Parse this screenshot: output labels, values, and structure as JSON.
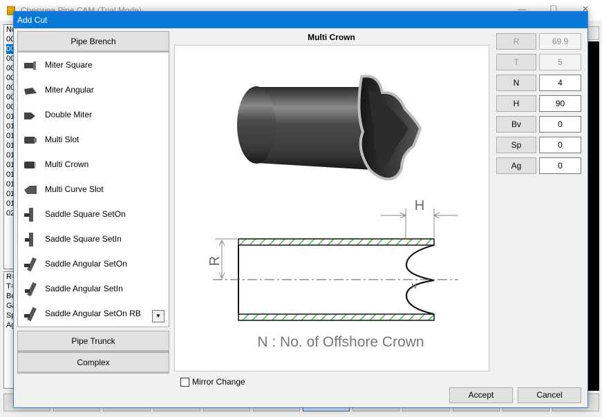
{
  "background_window": {
    "title": "Cheswee Pipe CAM (Trial Mode)",
    "list_header": "No",
    "list_rows": [
      "00",
      "00",
      "00",
      "00",
      "00",
      "00",
      "00",
      "00",
      "01",
      "01",
      "01",
      "01",
      "01",
      "01",
      "01",
      "01",
      "01",
      "01",
      "02"
    ],
    "info_lines": [
      "R=",
      "T=",
      "Be",
      "Ga",
      "Sp",
      "Ag"
    ]
  },
  "dialog": {
    "title": "Add Cut",
    "group_top": "Pipe Brench",
    "cuts": [
      {
        "label": "Miter Square",
        "icon": "pipe-miter-square-icon"
      },
      {
        "label": "Miter Angular",
        "icon": "pipe-miter-angular-icon"
      },
      {
        "label": "Double Miter",
        "icon": "pipe-double-miter-icon"
      },
      {
        "label": "Multi Slot",
        "icon": "pipe-multi-slot-icon"
      },
      {
        "label": "Multi Crown",
        "icon": "pipe-multi-crown-icon"
      },
      {
        "label": "Multi Curve Slot",
        "icon": "pipe-multi-curve-slot-icon"
      },
      {
        "label": "Saddle Square SetOn",
        "icon": "pipe-saddle-square-seton-icon"
      },
      {
        "label": "Saddle Square SetIn",
        "icon": "pipe-saddle-square-setin-icon"
      },
      {
        "label": "Saddle Angular SetOn",
        "icon": "pipe-saddle-angular-seton-icon"
      },
      {
        "label": "Saddle Angular SetIn",
        "icon": "pipe-saddle-angular-setin-icon"
      },
      {
        "label": "Saddle Angular SetOn RB",
        "icon": "pipe-saddle-angular-seton-rb-icon"
      }
    ],
    "group_middle": "Pipe Trunck",
    "group_bottom": "Complex",
    "preview_title": "Multi Crown",
    "diagram": {
      "dim_h": "H",
      "dim_r": "R",
      "dim_n": "N",
      "caption": "N : No. of Offshore Crown"
    },
    "mirror_label": "Mirror Change",
    "params": [
      {
        "label": "R",
        "value": "69.9",
        "enabled": false
      },
      {
        "label": "T",
        "value": "5",
        "enabled": false
      },
      {
        "label": "N",
        "value": "4",
        "enabled": true
      },
      {
        "label": "H",
        "value": "90",
        "enabled": true
      },
      {
        "label": "Bv",
        "value": "0",
        "enabled": true
      },
      {
        "label": "Sp",
        "value": "0",
        "enabled": true
      },
      {
        "label": "Ag",
        "value": "0",
        "enabled": true
      }
    ],
    "accept_label": "Accept",
    "cancel_label": "Cancel",
    "colors": {
      "title_bar": "#0a78d9",
      "hatch": "#3fbf3f"
    }
  }
}
